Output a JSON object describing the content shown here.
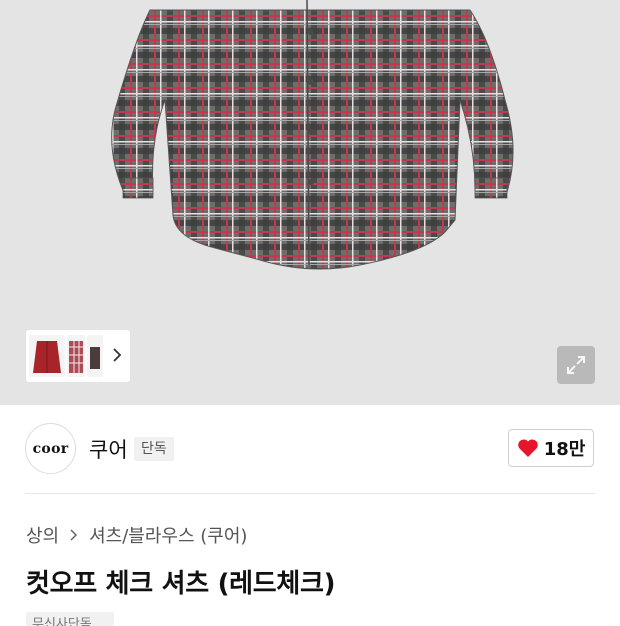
{
  "product_gallery": {
    "thumbnails": [
      "shirt-red-solid",
      "shirt-red-check",
      "shirt-dark"
    ],
    "thumbnail_more_icon": "chevron-right-icon",
    "expand_icon": "expand-arrows-icon"
  },
  "brand": {
    "logo_text": "coor",
    "name": "쿠어",
    "badge": "단독"
  },
  "like": {
    "icon": "heart-icon",
    "count": "18만",
    "color": "#e5162c"
  },
  "breadcrumb": {
    "items": [
      "상의",
      "셔츠/블라우스 (쿠어)"
    ],
    "separator_icon": "chevron-right-icon"
  },
  "product": {
    "title": "컷오프 체크 셔츠 (레드체크)",
    "tag": "무신사단독"
  }
}
